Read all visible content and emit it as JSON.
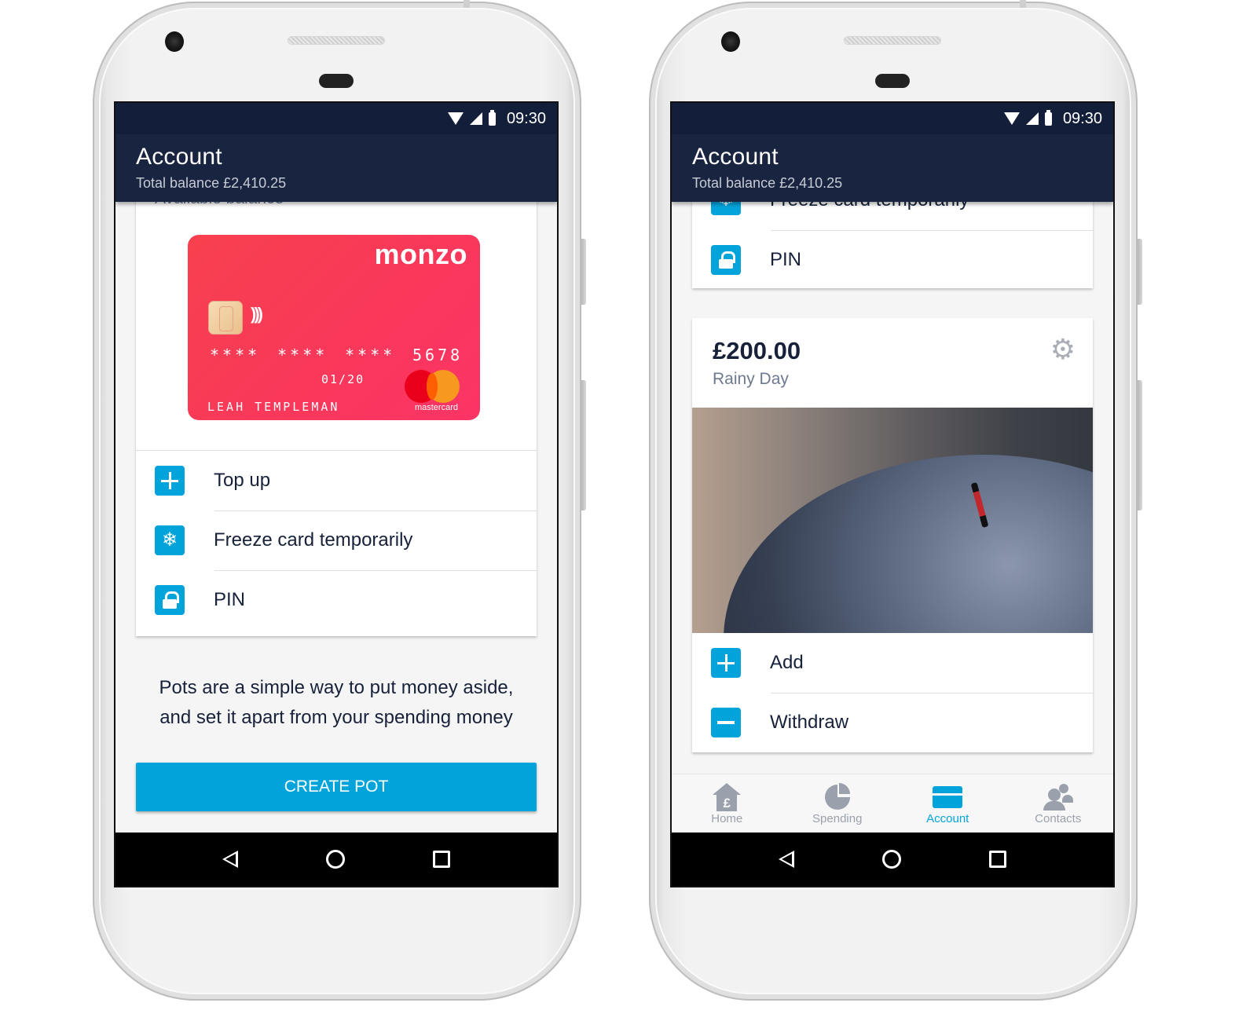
{
  "status_bar": {
    "time": "09:30",
    "icons": [
      "wifi-icon",
      "signal-icon",
      "battery-icon"
    ]
  },
  "header": {
    "title": "Account",
    "subtitle": "Total balance £2,410.25"
  },
  "left_screen": {
    "partial_label": "Available balance",
    "card": {
      "brand": "monzo",
      "number_groups": [
        "****",
        "****",
        "****",
        "5678"
      ],
      "expiry": "01/20",
      "holder": "LEAH TEMPLEMAN",
      "network": "mastercard",
      "color": "#f93a55"
    },
    "actions": [
      {
        "icon": "plus-icon",
        "label": "Top up"
      },
      {
        "icon": "snowflake-icon",
        "label": "Freeze card temporarily"
      },
      {
        "icon": "lock-icon",
        "label": "PIN"
      }
    ],
    "pots_description": "Pots are a simple way to put money aside, and set it apart from your spending money",
    "create_pot_label": "CREATE POT"
  },
  "right_screen": {
    "partial_action": "Freeze card temporarily",
    "pin_label": "PIN",
    "pot": {
      "amount": "£200.00",
      "name": "Rainy Day",
      "image": "umbrella-in-rain",
      "actions": [
        {
          "icon": "plus-icon",
          "label": "Add"
        },
        {
          "icon": "minus-icon",
          "label": "Withdraw"
        }
      ]
    },
    "tabs": [
      {
        "icon": "home-icon",
        "label": "Home",
        "active": false
      },
      {
        "icon": "spending-pie-icon",
        "label": "Spending",
        "active": false
      },
      {
        "icon": "account-card-icon",
        "label": "Account",
        "active": true
      },
      {
        "icon": "contacts-icon",
        "label": "Contacts",
        "active": false
      }
    ]
  },
  "colors": {
    "accent": "#00a4db",
    "header_bg": "#182440",
    "text_dark": "#17213a",
    "inactive": "#9aa1ad"
  }
}
